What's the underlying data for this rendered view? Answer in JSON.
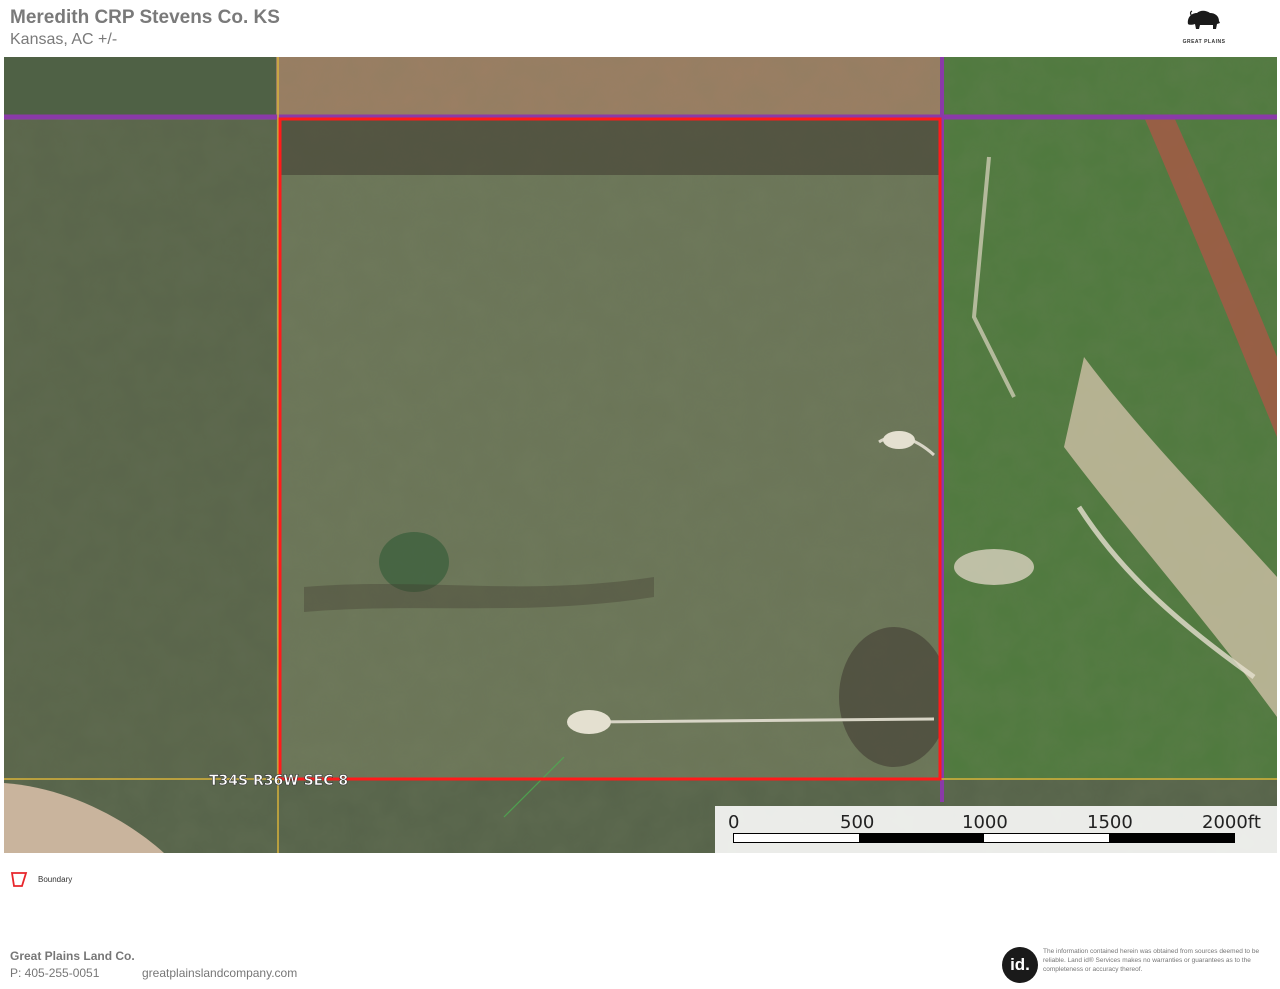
{
  "header": {
    "title": "Meredith CRP Stevens Co. KS",
    "subtitle": "Kansas,  AC +/-"
  },
  "logo": {
    "icon": "bison-icon",
    "text": "GREAT PLAINS"
  },
  "map": {
    "type": "aerial-imagery",
    "boundary_color": "#ff1a1a",
    "road_color": "#8a3aa8",
    "section_line_color": "#d8b23a",
    "section_label": "T34S R36W SEC 8"
  },
  "scale": {
    "labels": [
      "0",
      "500",
      "1000",
      "1500",
      "2000ft"
    ]
  },
  "legend": {
    "items": [
      {
        "icon": "boundary-icon",
        "label": "Boundary",
        "color": "#e8262b"
      }
    ]
  },
  "footer": {
    "company": "Great Plains Land Co.",
    "phone": "P: 405-255-0051",
    "website": "greatplainslandcompany.com",
    "badge": "id.",
    "disclaimer": "The information contained herein was obtained from sources deemed to be reliable. Land id® Services makes no warranties or guarantees as to the completeness or accuracy thereof."
  }
}
